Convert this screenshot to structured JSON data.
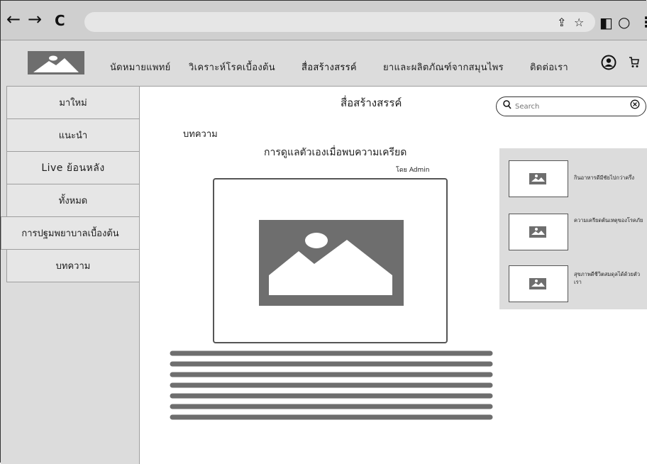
{
  "browser": {
    "back_icon": "←",
    "forward_icon": "→",
    "reload_icon": "C"
  },
  "header": {
    "menu": [
      {
        "label": "นัดหมายแพทย์"
      },
      {
        "label": "วิเคราะห์โรคเบื้องต้น"
      },
      {
        "label": "สื่อสร้างสรรค์"
      },
      {
        "label": "ยาและผลิตภัณฑ์จากสมุนไพร"
      },
      {
        "label": "ติดต่อเรา"
      }
    ]
  },
  "sidebar": {
    "items": [
      {
        "label": "มาใหม่"
      },
      {
        "label": "แนะนำ"
      },
      {
        "label": "Live ย้อนหลัง"
      },
      {
        "label": "ทั้งหมด"
      },
      {
        "label": "การปฐมพยาบาลเบื้องต้น"
      },
      {
        "label": "บทความ"
      }
    ]
  },
  "main": {
    "page_title": "สื่อสร้างสรรค์",
    "section": "บทความ",
    "article_title": "การดูแลตัวเองเมื่อพบความเครียด",
    "byline": "โดย Admin"
  },
  "search": {
    "placeholder": "Search"
  },
  "related": [
    {
      "title": "กินอาหารดีมีชัยไปกว่าครึ่ง"
    },
    {
      "title": "ความเครียดต้นเหตุของโรคภัย"
    },
    {
      "title": "สุขภาพดีชีวิตสมดุลได้ด้วยตัวเรา"
    }
  ],
  "colors": {
    "placeholder_gray": "#6e6e6e",
    "panel_gray": "#dcdcdc"
  }
}
